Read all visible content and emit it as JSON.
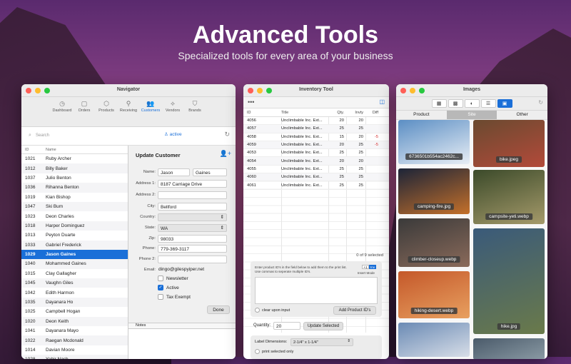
{
  "hero": {
    "title": "Advanced Tools",
    "subtitle": "Specialized tools for every area of your business"
  },
  "navigator": {
    "title": "Navigator",
    "tabs": [
      {
        "label": "Dashboard",
        "icon": "dashboard-icon",
        "glyph": "◷"
      },
      {
        "label": "Orders",
        "icon": "orders-icon",
        "glyph": "▢"
      },
      {
        "label": "Products",
        "icon": "products-icon",
        "glyph": "⬡"
      },
      {
        "label": "Receiving",
        "icon": "receiving-icon",
        "glyph": "⚲"
      },
      {
        "label": "Customers",
        "icon": "customers-icon",
        "glyph": "👥"
      },
      {
        "label": "Vendors",
        "icon": "vendors-icon",
        "glyph": "⟡"
      },
      {
        "label": "Brands",
        "icon": "brands-icon",
        "glyph": "⛉"
      }
    ],
    "active_tab": "Customers",
    "search_placeholder": "Search",
    "filter_label": "active",
    "list_headers": {
      "id": "ID",
      "name": "Name"
    },
    "customers": [
      {
        "id": "1021",
        "name": "Ruby Archer"
      },
      {
        "id": "1012",
        "name": "Billy Baker"
      },
      {
        "id": "1037",
        "name": "Julio Benton"
      },
      {
        "id": "1036",
        "name": "Rihanna Benton"
      },
      {
        "id": "1019",
        "name": "Kian Bishop"
      },
      {
        "id": "1047",
        "name": "Ski Bum"
      },
      {
        "id": "1023",
        "name": "Deon Charles"
      },
      {
        "id": "1018",
        "name": "Harper Dominguez"
      },
      {
        "id": "1013",
        "name": "Peyton Duarte"
      },
      {
        "id": "1033",
        "name": "Gabriel Frederick"
      },
      {
        "id": "1029",
        "name": "Jason Gaines"
      },
      {
        "id": "1040",
        "name": "Mohammed Gaines"
      },
      {
        "id": "1015",
        "name": "Clay Gallagher"
      },
      {
        "id": "1045",
        "name": "Vaughn Giles"
      },
      {
        "id": "1042",
        "name": "Edith Harmon"
      },
      {
        "id": "1035",
        "name": "Dayanara Ho"
      },
      {
        "id": "1025",
        "name": "Campbell Hogan"
      },
      {
        "id": "1020",
        "name": "Deon Keith"
      },
      {
        "id": "1041",
        "name": "Dayanara Mayo"
      },
      {
        "id": "1022",
        "name": "Raegan Mcdonald"
      },
      {
        "id": "1014",
        "name": "Davian Moore"
      },
      {
        "id": "1028",
        "name": "Yahir Nash"
      }
    ],
    "selected_id": "1029",
    "form": {
      "title": "Update Customer",
      "name_label": "Name:",
      "first_name": "Jason",
      "last_name": "Gaines",
      "address1_label": "Address 1:",
      "address1": "8187 Carriage Drive",
      "address2_label": "Address 2:",
      "address2": "",
      "city_label": "City:",
      "city": "Bellford",
      "country_label": "Country:",
      "country": "",
      "state_label": "State:",
      "state": "WA",
      "zip_label": "Zip:",
      "zip": "98033",
      "phone_label": "Phone:",
      "phone": "779-369-3117",
      "phone2_label": "Phone 2:",
      "phone2": "",
      "email_label": "Email:",
      "email": "dingo@gilespyiper.net",
      "newsletter_label": "Newsletter",
      "newsletter": false,
      "active_label": "Active",
      "active": true,
      "tax_exempt_label": "Tax Exempt",
      "tax_exempt": false,
      "done_label": "Done",
      "notes_label": "Notes"
    }
  },
  "inventory": {
    "title": "Inventory Tool",
    "headers": {
      "id": "ID",
      "title": "Title",
      "qty": "Qty.",
      "invty": "Invty",
      "diff": "Diff"
    },
    "rows": [
      {
        "id": "4056",
        "title": "Unclimbable Inc. Ext...",
        "qty": "20",
        "invty": "20",
        "diff": ""
      },
      {
        "id": "4057",
        "title": "Unclimbable Inc. Ext...",
        "qty": "25",
        "invty": "25",
        "diff": ""
      },
      {
        "id": "4058",
        "title": "Unclimbable Inc. Ext...",
        "qty": "15",
        "invty": "20",
        "diff": "-5"
      },
      {
        "id": "4059",
        "title": "Unclimbable Inc. Ext...",
        "qty": "20",
        "invty": "25",
        "diff": "-5"
      },
      {
        "id": "4053",
        "title": "Unclimbable Inc. Ext...",
        "qty": "25",
        "invty": "25",
        "diff": ""
      },
      {
        "id": "4054",
        "title": "Unclimbable Inc. Ext...",
        "qty": "20",
        "invty": "20",
        "diff": ""
      },
      {
        "id": "4055",
        "title": "Unclimbable Inc. Ext...",
        "qty": "25",
        "invty": "25",
        "diff": ""
      },
      {
        "id": "4060",
        "title": "Unclimbable Inc. Ext...",
        "qty": "25",
        "invty": "25",
        "diff": ""
      },
      {
        "id": "4061",
        "title": "Unclimbable Inc. Ext...",
        "qty": "25",
        "invty": "25",
        "diff": ""
      }
    ],
    "selection_count": "0 of 9 selected",
    "instructions": "Enter product ID's in the field below to add them to the print list. Use commas to seperate multiple ID's.",
    "mode_options": [
      "+1",
      "Inv"
    ],
    "mode_selected": "Inv",
    "insert_mode_label": "Insert Mode",
    "clear_label": "clear upon input",
    "add_button": "Add Product ID's",
    "quantity_label": "Quantity:",
    "quantity": "20",
    "update_button": "Update Selected",
    "label_dims_label": "Label Dimensions:",
    "label_dims": "2-1/4\" x 1-1/4\"",
    "print_selected_label": "print selected only"
  },
  "images": {
    "title": "Images",
    "toolbar_icons": [
      "grid-large-icon",
      "grid-small-icon",
      "contrast-icon",
      "list-icon",
      "image-icon"
    ],
    "toolbar_glyphs": [
      "▦",
      "▩",
      "◐",
      "☰",
      "▣"
    ],
    "segments": [
      "Product",
      "Site",
      "Other"
    ],
    "segment_selected": "Site",
    "thumbs": [
      {
        "caption": "6736501b554ac2462c...",
        "colors": [
          "#5b8ec4",
          "#e8eef5"
        ]
      },
      {
        "caption": "bike.jpeg",
        "colors": [
          "#6a4a30",
          "#b34a3a"
        ]
      },
      {
        "caption": "camping-fire.jpg",
        "colors": [
          "#1c2438",
          "#c4702a"
        ]
      },
      {
        "caption": "campsite-yeti.webp",
        "colors": [
          "#3b4a2a",
          "#a59a6a"
        ]
      },
      {
        "caption": "climber-closeup.webp",
        "colors": [
          "#3a3a3a",
          "#8a6a5a"
        ]
      },
      {
        "caption": "hike.jpg",
        "colors": [
          "#3a5a7a",
          "#6a7a4a"
        ]
      },
      {
        "caption": "hiking-desert.webp",
        "colors": [
          "#c4582a",
          "#e8a060"
        ]
      },
      {
        "caption": "",
        "colors": [
          "#6a8ab4",
          "#d8dee8"
        ]
      },
      {
        "caption": "",
        "colors": [
          "#4a5a6a",
          "#8a9aa4"
        ]
      }
    ]
  }
}
